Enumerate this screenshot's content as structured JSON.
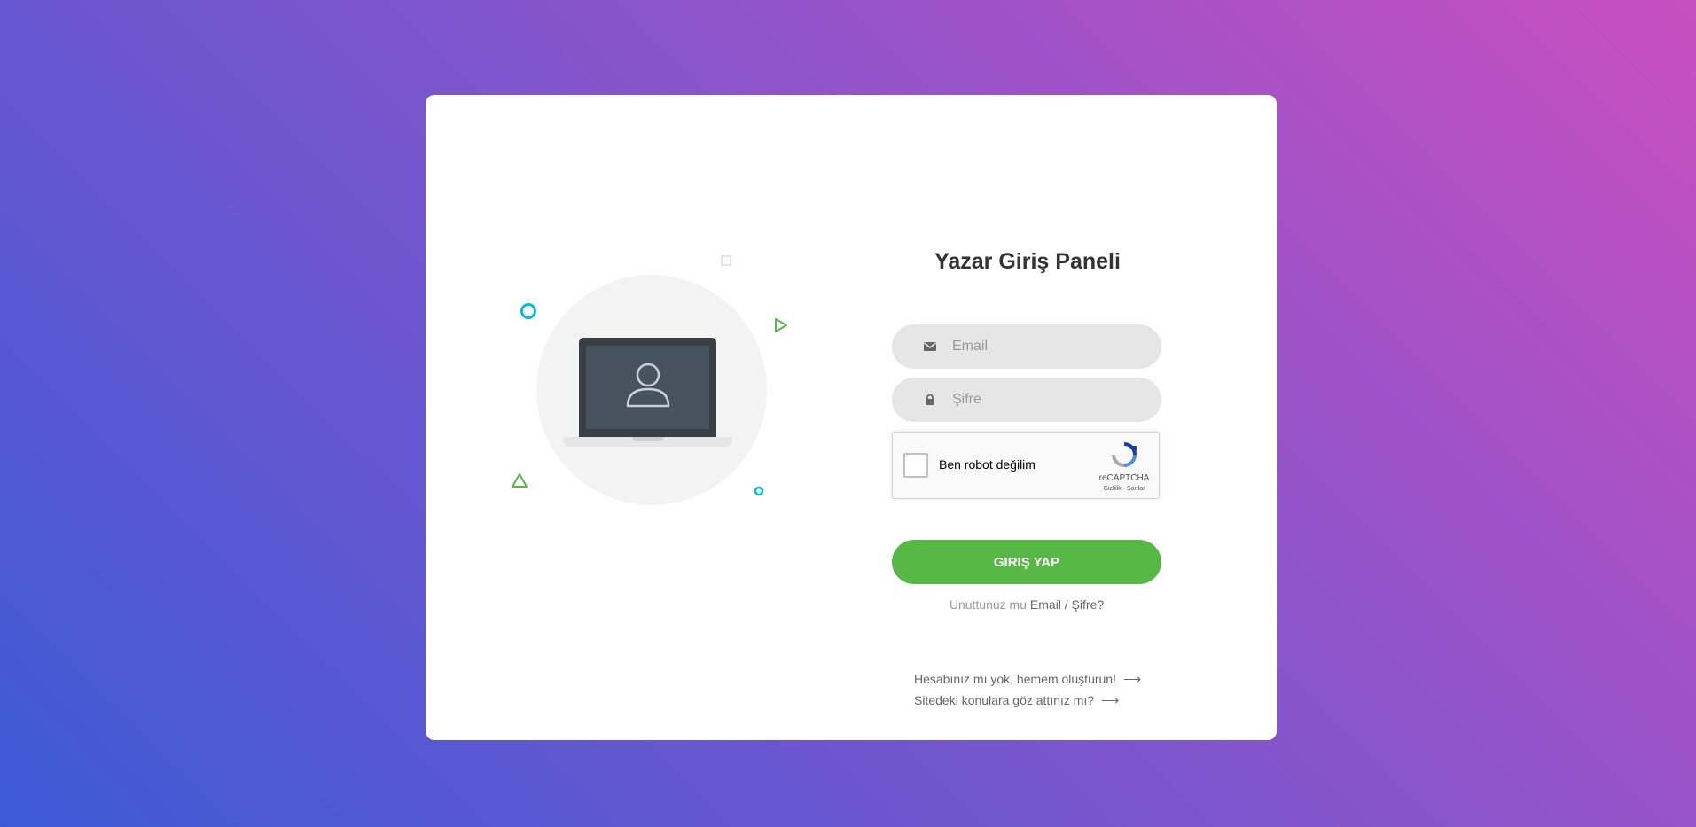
{
  "form": {
    "title": "Yazar Giriş Paneli",
    "email_placeholder": "Email",
    "password_placeholder": "Şifre",
    "email_icon": "envelope-icon",
    "password_icon": "lock-icon"
  },
  "recaptcha": {
    "label": "Ben robot değilim",
    "brand": "reCAPTCHA",
    "terms": "Gizlilik - Şartlar"
  },
  "login_button": {
    "label": "GIRIŞ YAP",
    "color": "#57b846"
  },
  "forgot": {
    "prefix": "Unuttunuz mu",
    "link": "Email / Şifre?"
  },
  "links": {
    "signup": "Hesabınız mı yok, hemem oluşturun!",
    "topics": "Sitedeki konulara göz attınız mı?",
    "arrow": "⟶"
  },
  "colors": {
    "accent_green": "#57b846",
    "accent_cyan": "#00bcd4",
    "field_bg": "#e6e6e6",
    "gradient_start": "#3d5ad6",
    "gradient_end": "#c84fc0"
  }
}
